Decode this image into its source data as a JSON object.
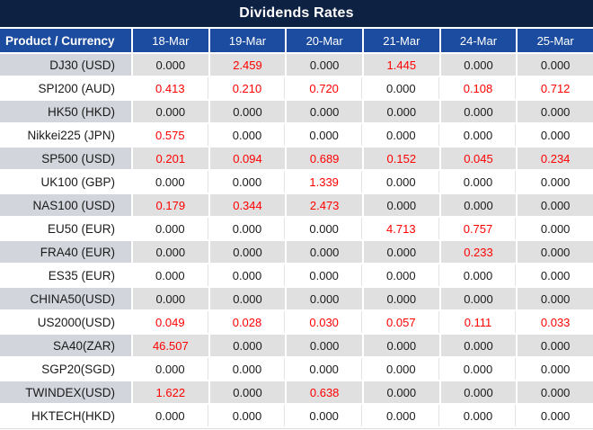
{
  "chart_data": {
    "type": "table",
    "title": "Dividends Rates",
    "columns": [
      "Product / Currency",
      "18-Mar",
      "19-Mar",
      "20-Mar",
      "21-Mar",
      "24-Mar",
      "25-Mar"
    ],
    "rows": [
      {
        "product": "DJ30 (USD)",
        "values": [
          "0.000",
          "2.459",
          "0.000",
          "1.445",
          "0.000",
          "0.000"
        ],
        "red_flags": [
          false,
          true,
          false,
          true,
          false,
          false
        ]
      },
      {
        "product": "SPI200 (AUD)",
        "values": [
          "0.413",
          "0.210",
          "0.720",
          "0.000",
          "0.108",
          "0.712"
        ],
        "red_flags": [
          true,
          true,
          true,
          false,
          true,
          true
        ]
      },
      {
        "product": "HK50 (HKD)",
        "values": [
          "0.000",
          "0.000",
          "0.000",
          "0.000",
          "0.000",
          "0.000"
        ],
        "red_flags": [
          false,
          false,
          false,
          false,
          false,
          false
        ]
      },
      {
        "product": "Nikkei225 (JPN)",
        "values": [
          "0.575",
          "0.000",
          "0.000",
          "0.000",
          "0.000",
          "0.000"
        ],
        "red_flags": [
          true,
          false,
          false,
          false,
          false,
          false
        ]
      },
      {
        "product": "SP500 (USD)",
        "values": [
          "0.201",
          "0.094",
          "0.689",
          "0.152",
          "0.045",
          "0.234"
        ],
        "red_flags": [
          true,
          true,
          true,
          true,
          true,
          true
        ]
      },
      {
        "product": "UK100 (GBP)",
        "values": [
          "0.000",
          "0.000",
          "1.339",
          "0.000",
          "0.000",
          "0.000"
        ],
        "red_flags": [
          false,
          false,
          true,
          false,
          false,
          false
        ]
      },
      {
        "product": "NAS100 (USD)",
        "values": [
          "0.179",
          "0.344",
          "2.473",
          "0.000",
          "0.000",
          "0.000"
        ],
        "red_flags": [
          true,
          true,
          true,
          false,
          false,
          false
        ]
      },
      {
        "product": "EU50 (EUR)",
        "values": [
          "0.000",
          "0.000",
          "0.000",
          "4.713",
          "0.757",
          "0.000"
        ],
        "red_flags": [
          false,
          false,
          false,
          true,
          true,
          false
        ]
      },
      {
        "product": "FRA40 (EUR)",
        "values": [
          "0.000",
          "0.000",
          "0.000",
          "0.000",
          "0.233",
          "0.000"
        ],
        "red_flags": [
          false,
          false,
          false,
          false,
          true,
          false
        ]
      },
      {
        "product": "ES35 (EUR)",
        "values": [
          "0.000",
          "0.000",
          "0.000",
          "0.000",
          "0.000",
          "0.000"
        ],
        "red_flags": [
          false,
          false,
          false,
          false,
          false,
          false
        ]
      },
      {
        "product": "CHINA50(USD)",
        "values": [
          "0.000",
          "0.000",
          "0.000",
          "0.000",
          "0.000",
          "0.000"
        ],
        "red_flags": [
          false,
          false,
          false,
          false,
          false,
          false
        ]
      },
      {
        "product": "US2000(USD)",
        "values": [
          "0.049",
          "0.028",
          "0.030",
          "0.057",
          "0.111",
          "0.033"
        ],
        "red_flags": [
          true,
          true,
          true,
          true,
          true,
          true
        ]
      },
      {
        "product": "SA40(ZAR)",
        "values": [
          "46.507",
          "0.000",
          "0.000",
          "0.000",
          "0.000",
          "0.000"
        ],
        "red_flags": [
          true,
          false,
          false,
          false,
          false,
          false
        ]
      },
      {
        "product": "SGP20(SGD)",
        "values": [
          "0.000",
          "0.000",
          "0.000",
          "0.000",
          "0.000",
          "0.000"
        ],
        "red_flags": [
          false,
          false,
          false,
          false,
          false,
          false
        ]
      },
      {
        "product": "TWINDEX(USD)",
        "values": [
          "1.622",
          "0.000",
          "0.638",
          "0.000",
          "0.000",
          "0.000"
        ],
        "red_flags": [
          true,
          false,
          true,
          false,
          false,
          false
        ]
      },
      {
        "product": "HKTECH(HKD)",
        "values": [
          "0.000",
          "0.000",
          "0.000",
          "0.000",
          "0.000",
          "0.000"
        ],
        "red_flags": [
          false,
          false,
          false,
          false,
          false,
          false
        ]
      }
    ],
    "layout": {
      "grid": "on",
      "alternating_rows": true,
      "red_means": "non-zero dividend rate"
    }
  },
  "colors": {
    "title_bg": "#0d2142",
    "header_bg": "#1b4ca0",
    "header_text": "#ffffff",
    "alt_row_bg": "#e0e0e0",
    "alt_row_label_bg": "#d2d6dc",
    "plain_row_bg": "#ffffff",
    "value_text": "#1a1a1a",
    "value_red": "#ff0000"
  }
}
